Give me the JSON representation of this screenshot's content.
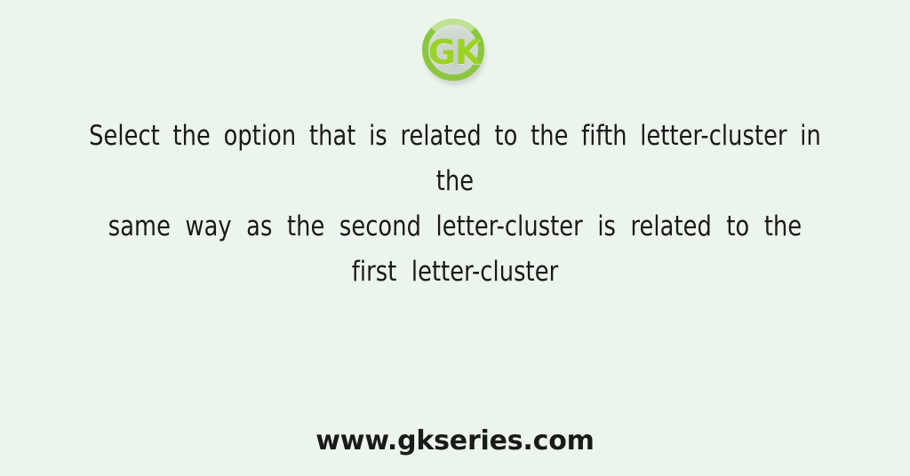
{
  "background_color": "#ecf5ec",
  "logo": {
    "icon": "gk-circle-logo",
    "text": "GK",
    "ring_color": "#8cc63f",
    "letter_color": "#9ad321"
  },
  "question": {
    "line_1": "Select the option that is related to the fifth letter-cluster in the",
    "line_2": "same way as the second letter-cluster is related to the first letter-cluster",
    "text_color": "#1a1a1a"
  },
  "footer": {
    "website": "www.gkseries.com",
    "text_color": "#1a1a1a"
  }
}
